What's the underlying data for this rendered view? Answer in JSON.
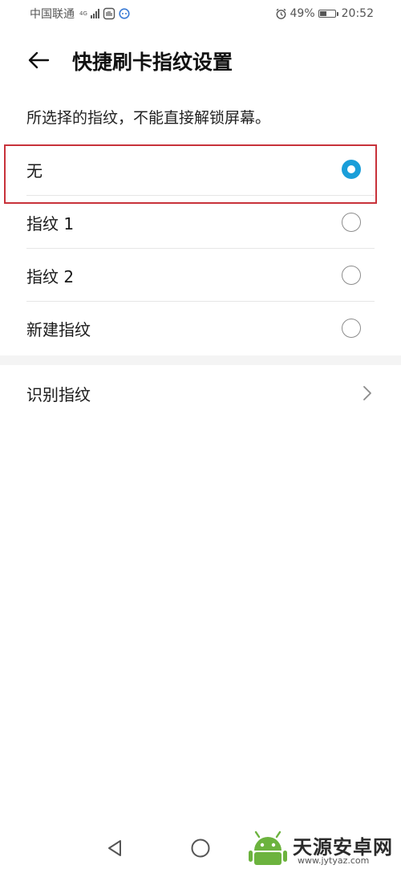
{
  "status_bar": {
    "carrier": "中国联通",
    "network": "4G",
    "battery_percent": "49%",
    "battery_level": 0.49,
    "time": "20:52",
    "icons": [
      "signal-icon",
      "notification-icon",
      "app-icon",
      "alarm-icon",
      "battery-icon"
    ]
  },
  "header": {
    "title": "快捷刷卡指纹设置",
    "back_icon": "arrow-left-icon"
  },
  "description": "所选择的指纹，不能直接解锁屏幕。",
  "options": [
    {
      "label": "无",
      "selected": true
    },
    {
      "label": "指纹 1",
      "selected": false
    },
    {
      "label": "指纹 2",
      "selected": false
    },
    {
      "label": "新建指纹",
      "selected": false
    }
  ],
  "identify": {
    "label": "识别指纹",
    "icon": "chevron-right-icon"
  },
  "nav": {
    "icons": [
      "back-triangle-icon",
      "home-circle-icon"
    ]
  },
  "watermark": {
    "text": "天源安卓网",
    "url": "www.jytyaz.com"
  },
  "colors": {
    "accent": "#1a9ed9",
    "highlight": "#c8323a",
    "text": "#1a1a1a",
    "divider": "#e6e6e6"
  }
}
